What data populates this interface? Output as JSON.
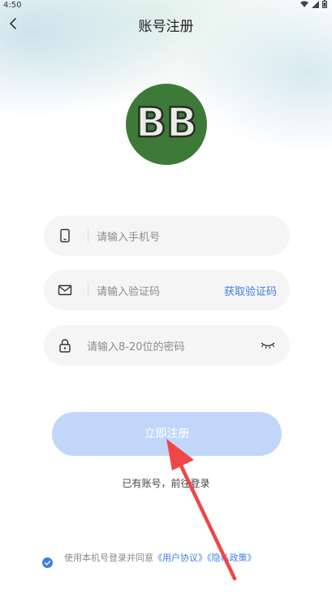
{
  "status_bar": {
    "time": "4:50"
  },
  "header": {
    "title": "账号注册"
  },
  "logo": {
    "text": "BB"
  },
  "phone_field": {
    "placeholder": "请输入手机号"
  },
  "code_field": {
    "placeholder": "请输入验证码",
    "get_code_label": "获取验证码"
  },
  "password_field": {
    "placeholder": "请输入8-20位的密码"
  },
  "register_button": {
    "label": "立即注册"
  },
  "login_link": {
    "label": "已有账号，前往登录"
  },
  "agreement": {
    "prefix": "使用本机号登录并同意",
    "user_agreement": "《用户协议》",
    "privacy_policy": "《隐私政策》"
  },
  "colors": {
    "accent": "#3e7ee6",
    "button_bg": "#c2d6fa",
    "logo_bg": "#3e7a37",
    "arrow": "#f04646"
  },
  "icons": [
    "back-arrow-icon",
    "wifi-icon",
    "signal-icon",
    "battery-icon",
    "phone-icon",
    "mail-icon",
    "lock-icon",
    "eye-closed-icon",
    "check-circle-icon"
  ]
}
